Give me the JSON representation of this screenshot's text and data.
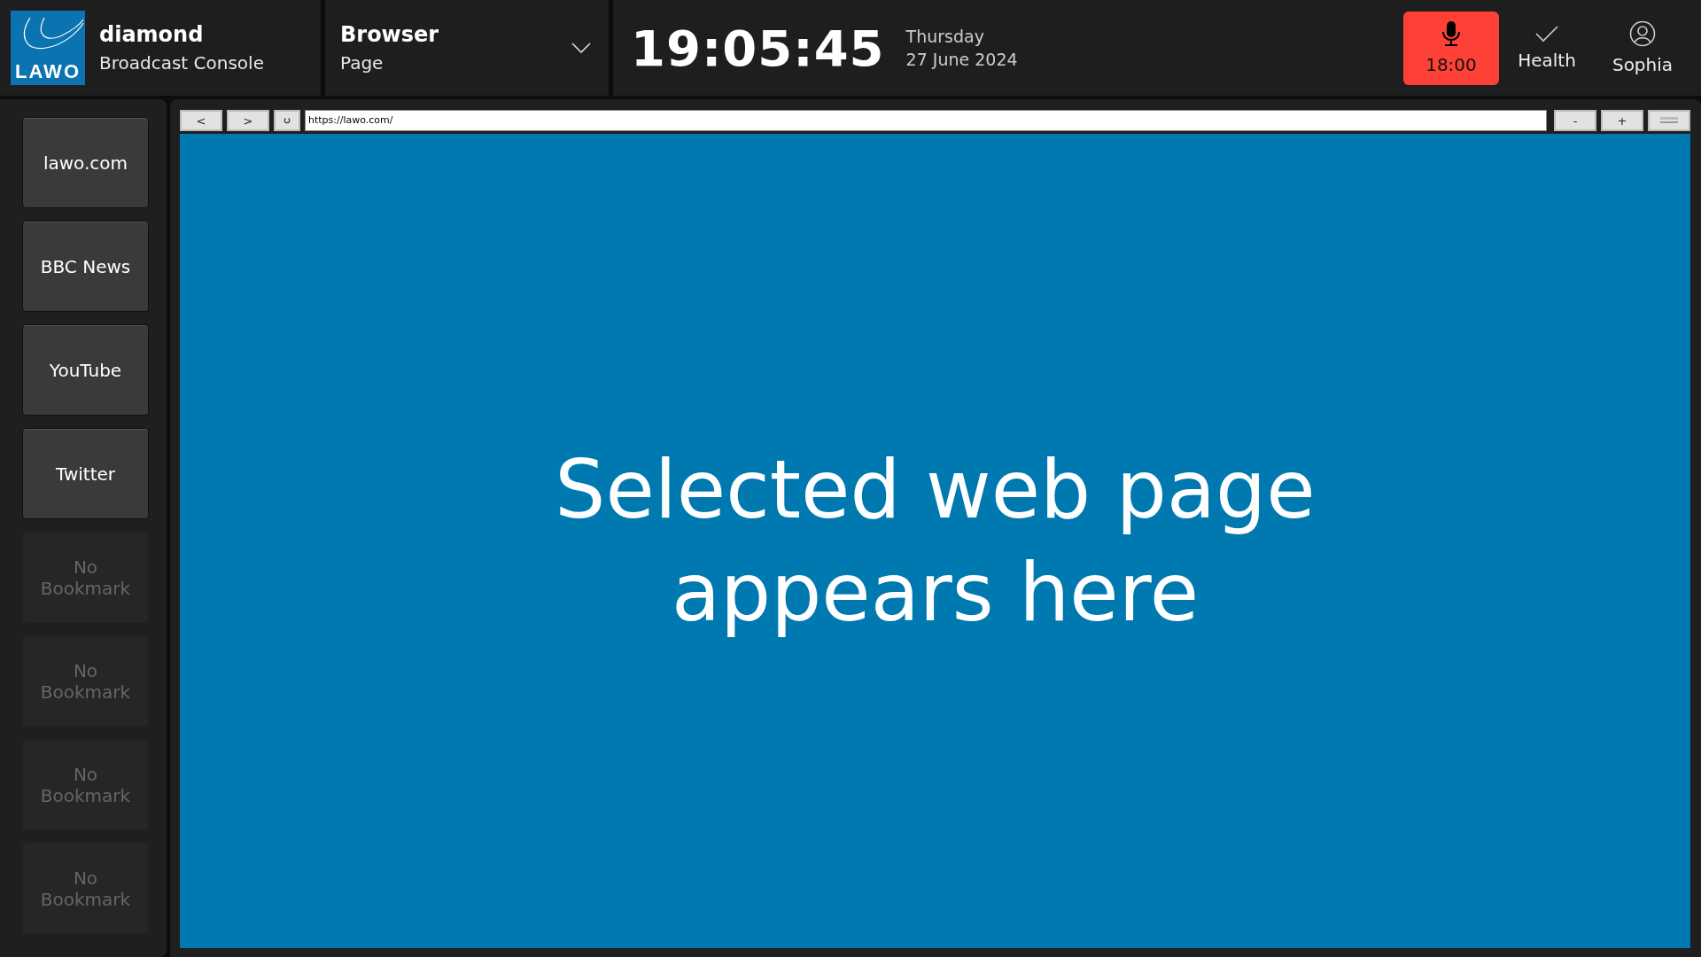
{
  "header": {
    "logo_text": "LAWO",
    "product": "diamond",
    "subtitle": "Broadcast Console",
    "page_selector": {
      "title": "Browser",
      "subtitle": "Page"
    },
    "time": "19:05:45",
    "weekday": "Thursday",
    "date": "27 June 2024",
    "actions": [
      {
        "kind": "mic",
        "label": "18:00",
        "active": true
      },
      {
        "kind": "health",
        "label": "Health",
        "active": false
      },
      {
        "kind": "user",
        "label": "Sophia",
        "active": false
      }
    ]
  },
  "bookmarks": [
    {
      "kind": "link",
      "label": "lawo.com"
    },
    {
      "kind": "link",
      "label": "BBC News"
    },
    {
      "kind": "link",
      "label": "YouTube"
    },
    {
      "kind": "link",
      "label": "Twitter"
    },
    {
      "kind": "empty",
      "label": "No Bookmark"
    },
    {
      "kind": "empty",
      "label": "No Bookmark"
    },
    {
      "kind": "empty",
      "label": "No Bookmark"
    },
    {
      "kind": "empty",
      "label": "No Bookmark"
    }
  ],
  "browser": {
    "back": "<",
    "forward": ">",
    "url": "https://lawo.com/",
    "zoom_out": "-",
    "zoom_in": "+",
    "content_text": "Selected web page appears here"
  }
}
